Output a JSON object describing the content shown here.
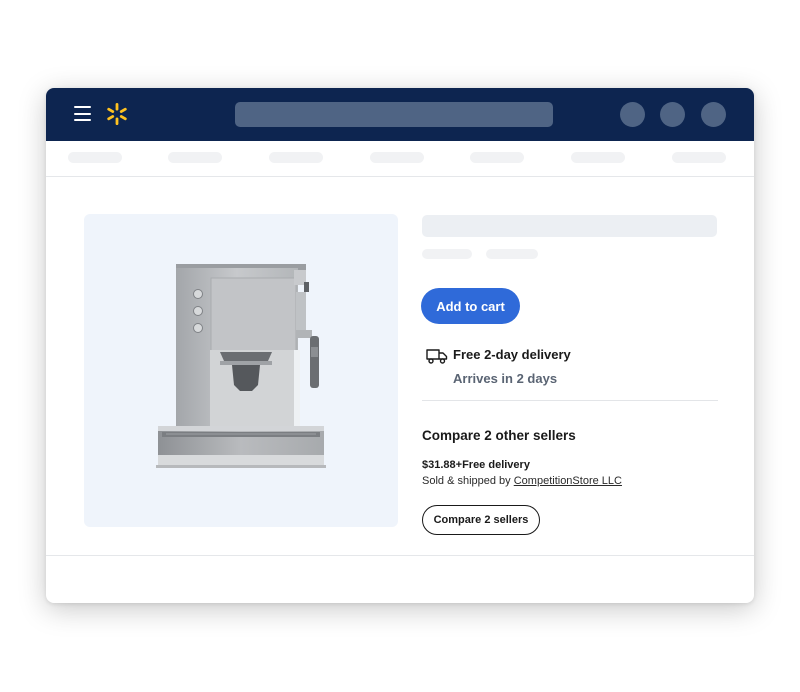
{
  "header": {
    "brand_color": "#0d2550",
    "logo_icon": "spark-logo-icon",
    "menu_icon": "hamburger-icon",
    "accent": "#ffc220"
  },
  "product": {
    "image_icon": "espresso-machine-image",
    "add_to_cart_label": "Add to cart",
    "delivery": {
      "icon": "truck-icon",
      "title": "Free 2-day delivery",
      "subtitle": "Arrives in 2 days"
    }
  },
  "sellers": {
    "heading": "Compare 2 other sellers",
    "price_line": "$31.88+Free delivery",
    "sold_prefix": "Sold & shipped by ",
    "seller_name": "CompetitionStore LLC",
    "button_label": "Compare 2 sellers"
  },
  "colors": {
    "primary_button": "#2f6ad9",
    "image_bg": "#eff4fb"
  }
}
